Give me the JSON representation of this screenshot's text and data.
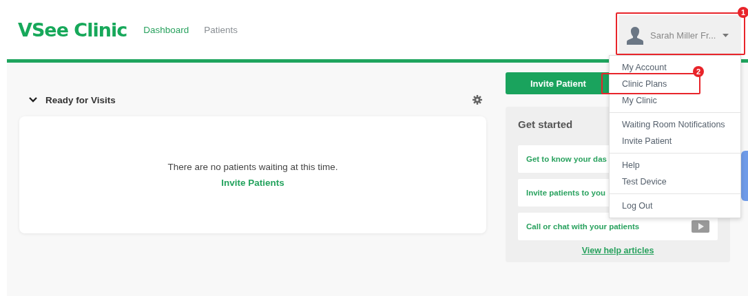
{
  "header": {
    "logo": "VSee Clinic",
    "nav": [
      {
        "label": "Dashboard",
        "selected": true
      },
      {
        "label": "Patients",
        "selected": false
      }
    ],
    "user": {
      "name": "Sarah Miller Fr..."
    }
  },
  "visits": {
    "title": "Ready for Visits",
    "expanded": true,
    "empty_message": "There are no patients waiting at this time.",
    "link": "Invite Patients"
  },
  "invite_button": "Invite Patient",
  "get_started": {
    "title": "Get started",
    "items": [
      {
        "label": "Get to know your das"
      },
      {
        "label": "Invite patients to you"
      },
      {
        "label": "Call or chat with your patients",
        "video": true
      }
    ],
    "link": "View help articles"
  },
  "menu": {
    "groups": [
      [
        "My Account",
        "Clinic Plans",
        "My Clinic"
      ],
      [
        "Waiting Room Notifications",
        "Invite Patient"
      ],
      [
        "Help",
        "Test Device"
      ],
      [
        "Log Out"
      ]
    ]
  },
  "callouts": [
    {
      "number": "1"
    },
    {
      "number": "2"
    }
  ]
}
